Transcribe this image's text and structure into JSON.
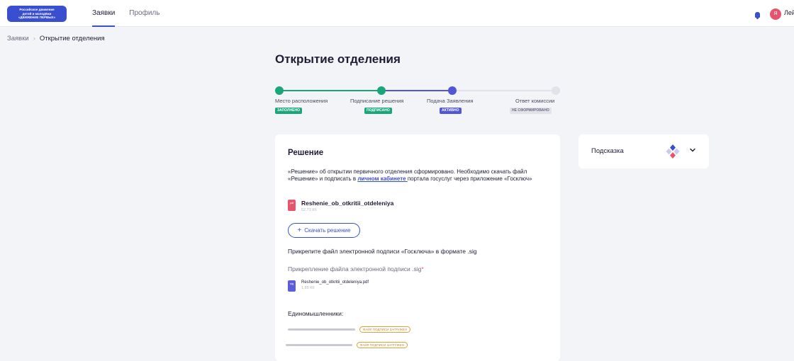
{
  "header": {
    "logo_lines": [
      "Российское движение",
      "детей и молодёжи",
      "«ДВИЖЕНИЕ ПЕРВЫХ»"
    ],
    "nav": [
      {
        "label": "Заявки",
        "active": true
      },
      {
        "label": "Профиль",
        "active": false
      }
    ],
    "avatar_letter": "Я",
    "user_name": "Лей"
  },
  "breadcrumb": {
    "root": "Заявки",
    "separator": "›",
    "current": "Открытие отделения"
  },
  "page_title": "Открытие отделения",
  "stepper": {
    "steps": [
      {
        "label": "Место расположения",
        "badge": "заполнено",
        "status": "done"
      },
      {
        "label": "Подписание решения",
        "badge": "подписано",
        "status": "done"
      },
      {
        "label": "Подача Заявления",
        "badge": "активно",
        "status": "active"
      },
      {
        "label": "Ответ комиссии",
        "badge": "не сформировано",
        "status": "pending"
      }
    ]
  },
  "decision_card": {
    "title": "Решение",
    "description_before": "«Решение» об открытии первичного отделения сформировано. Необходимо скачать файл «Решение» и подписать в ",
    "description_link": "личном кабинете ",
    "description_after": "портала госуслуг через приложение «Госключ»",
    "file": {
      "name": "Reshenie_ob_otkritii_otdeleniya",
      "size": "52,73 Кб",
      "icon_text": "pdf"
    },
    "download_label": "Скачать решение",
    "attach_instruction": "Прикрепите файл электронной подписи «Госключа» в формате .sig",
    "attach_label": "Прикрепление файла электронной подписи .sig",
    "required_mark": "*",
    "sig_file": {
      "name": "Reshenie_ob_otkritii_otdeleniya.pdf",
      "size": "1,85 Кб",
      "icon_text": "sig"
    },
    "like_minded_title": "Единомышленники:",
    "members": [
      {
        "status": "файл подписи загружен"
      },
      {
        "status": "файл подписи загружен"
      }
    ]
  },
  "hint": {
    "title": "Подсказка"
  },
  "colors": {
    "done": "#1aa67a",
    "active": "#5056d6",
    "pending": "#e2e3ea",
    "accent": "#3a4fcf",
    "pdf": "#e5556d",
    "uploaded": "#d9a23b"
  }
}
